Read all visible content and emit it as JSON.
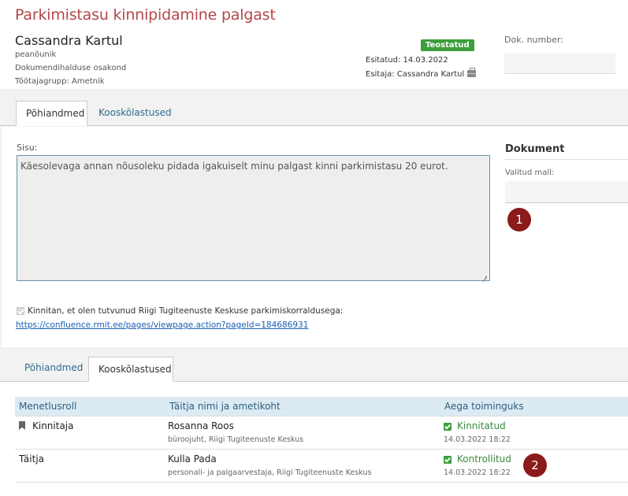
{
  "page": {
    "title": "Parkimistasu kinnipidamine palgast"
  },
  "person": {
    "name": "Cassandra Kartul",
    "position": "peanõunik",
    "department": "Dokumendihalduse osakond",
    "group": "Töötajagrupp: Ametnik"
  },
  "document_meta": {
    "status": "Teostatud",
    "submitted": "Esitatud: 14.03.2022",
    "submitter": "Esitaja: Cassandra Kartul",
    "number_label": "Dok. number:",
    "number_value": ""
  },
  "tabs_top": [
    {
      "label": "Põhiandmed",
      "active": true
    },
    {
      "label": "Kooskõlastused",
      "active": false
    }
  ],
  "content": {
    "sisu_label": "Sisu:",
    "sisu_value": "Käesolevaga annan nõusoleku pidada igakuiselt minu palgast kinni parkimistasu 20 eurot.",
    "confirm_text": "Kinnitan, et olen tutvunud Riigi Tugiteenuste Keskuse parkimiskorraldusega:",
    "confirm_link": "https://confluence.rmit.ee/pages/viewpage.action?pageId=184686931",
    "confirm_checked": true
  },
  "document_panel": {
    "title": "Dokument",
    "template_label": "Valitud mall:",
    "template_value": ""
  },
  "markers": [
    "1",
    "2"
  ],
  "tabs_bottom": [
    {
      "label": "Põhiandmed",
      "active": false
    },
    {
      "label": "Kooskõlastused",
      "active": true
    }
  ],
  "approvals": {
    "headers": [
      "Menetlusroll",
      "Täitja nimi ja ametikoht",
      "Aega toiminguks"
    ],
    "rows": [
      {
        "role": "Kinnitaja",
        "name": "Rosanna Roos",
        "position": "büroojuht, Riigi Tugiteenuste Keskus",
        "status": "Kinnitatud",
        "time": "14.03.2022 18:22"
      },
      {
        "role": "Täitja",
        "name": "Kulla Pada",
        "position": "personali- ja palgaarvestaja, Riigi Tugiteenuste Keskus",
        "status": "Kontrollitud",
        "time": "14.03.2022 18:22"
      }
    ]
  },
  "colors": {
    "title": "#b5474a",
    "badge": "#3c9e3c",
    "link": "#1a5fb4",
    "table_header_bg": "#dcebf3",
    "marker": "#8b1a1a"
  }
}
